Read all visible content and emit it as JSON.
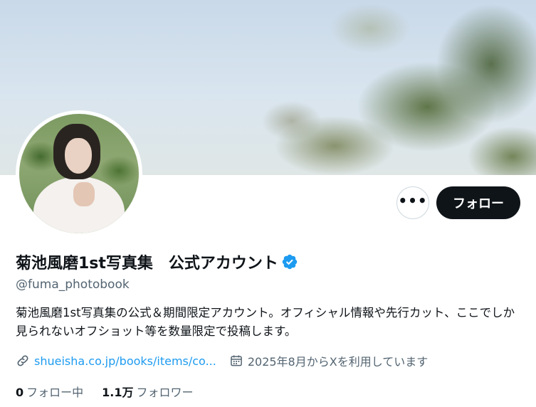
{
  "profile": {
    "display_name": "菊池風磨1st写真集　公式アカウント",
    "handle": "@fuma_photobook",
    "bio": "菊池風磨1st写真集の公式＆期間限定アカウント。オフィシャル情報や先行カット、ここでしか見られないオフショット等を数量限定で投稿します。",
    "website": "shueisha.co.jp/books/items/co...",
    "joined": "2025年8月からXを利用しています",
    "verified": true
  },
  "actions": {
    "more_label": "•••",
    "follow_label": "フォロー"
  },
  "stats": {
    "following_count": "0",
    "following_label": "フォロー中",
    "followers_count": "1.1万",
    "followers_label": "フォロワー"
  },
  "icons": {
    "more": "more-horizontal-icon",
    "verified": "verified-badge-icon",
    "link": "link-icon",
    "calendar": "calendar-icon"
  },
  "colors": {
    "follow_button_bg": "#0f1419",
    "link": "#1d9bf0",
    "verified_badge": "#1d9bf0",
    "secondary_text": "#536471"
  }
}
